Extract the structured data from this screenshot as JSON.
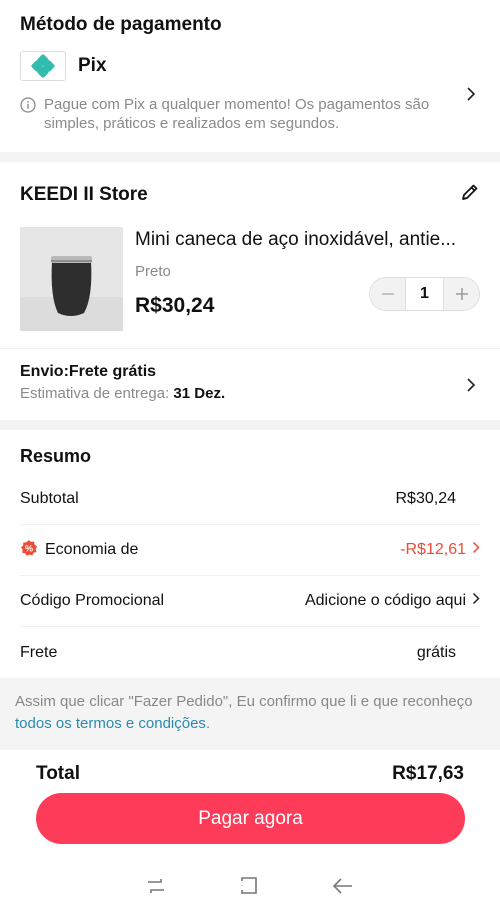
{
  "payment": {
    "title": "Método de pagamento",
    "method_name": "Pix",
    "description": "Pague com Pix a qualquer momento! Os pagamentos são simples, práticos e realizados em segundos."
  },
  "store": {
    "name": "KEEDI II Store",
    "product": {
      "title": "Mini caneca de aço inoxidável, antie...",
      "variant": "Preto",
      "price": "R$30,24",
      "quantity": "1"
    },
    "shipping": {
      "method": "Envio:Frete grátis",
      "estimate_label": "Estimativa de entrega: ",
      "estimate_date": "31 Dez."
    }
  },
  "summary": {
    "title": "Resumo",
    "subtotal_label": "Subtotal",
    "subtotal_value": "R$30,24",
    "discount_label": "Economia de",
    "discount_value": "-R$12,61",
    "promo_label": "Código Promocional",
    "promo_value": "Adicione o código aqui",
    "freight_label": "Frete",
    "freight_value": "grátis"
  },
  "terms": {
    "text": "Assim que clicar \"Fazer Pedido\", Eu confirmo que li e que reconheço ",
    "link": "todos os termos e condições",
    "end": "."
  },
  "total": {
    "label": "Total",
    "value": "R$17,63"
  },
  "pay_button": "Pagar agora",
  "colors": {
    "accent": "#fe3b58",
    "discount": "#ec4b37",
    "pix": "#32bcad",
    "link": "#2a8bb0"
  }
}
